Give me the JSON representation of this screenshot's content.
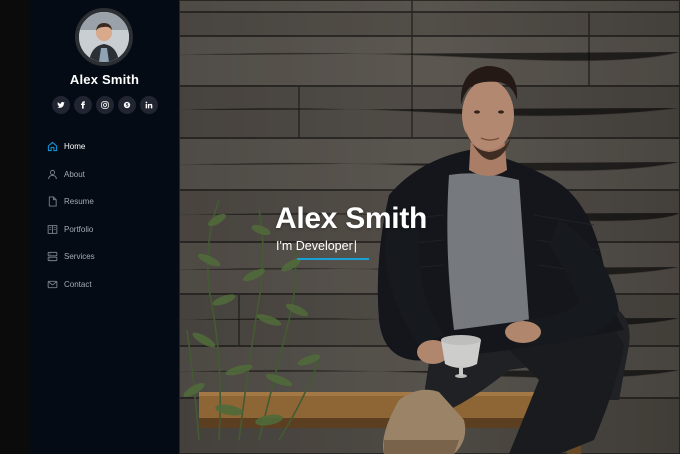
{
  "sidebar": {
    "name": "Alex Smith",
    "socials": [
      {
        "icon": "twitter-icon"
      },
      {
        "icon": "facebook-icon"
      },
      {
        "icon": "instagram-icon"
      },
      {
        "icon": "skype-icon"
      },
      {
        "icon": "linkedin-icon"
      }
    ],
    "nav": [
      {
        "label": "Home",
        "icon": "home-icon",
        "active": true
      },
      {
        "label": "About",
        "icon": "person-icon",
        "active": false
      },
      {
        "label": "Resume",
        "icon": "file-icon",
        "active": false
      },
      {
        "label": "Portfolio",
        "icon": "book-icon",
        "active": false
      },
      {
        "label": "Services",
        "icon": "server-icon",
        "active": false
      },
      {
        "label": "Contact",
        "icon": "envelope-icon",
        "active": false
      }
    ]
  },
  "hero": {
    "title": "Alex Smith",
    "subtitle_prefix": "I'm",
    "subtitle_role": "Developer",
    "caret": "|"
  },
  "colors": {
    "sidebar_bg": "#040b14",
    "accent": "#149ddd",
    "nav_active_icon": "#149ddd",
    "nav_text": "#a8a9b4"
  }
}
